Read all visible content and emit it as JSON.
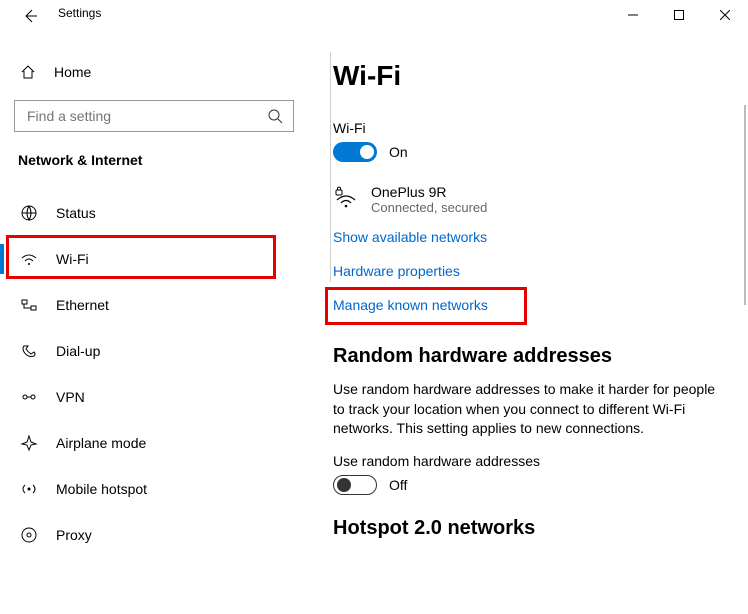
{
  "window": {
    "title": "Settings"
  },
  "sidebar": {
    "home": "Home",
    "search_placeholder": "Find a setting",
    "section": "Network & Internet",
    "items": [
      {
        "label": "Status"
      },
      {
        "label": "Wi-Fi"
      },
      {
        "label": "Ethernet"
      },
      {
        "label": "Dial-up"
      },
      {
        "label": "VPN"
      },
      {
        "label": "Airplane mode"
      },
      {
        "label": "Mobile hotspot"
      },
      {
        "label": "Proxy"
      }
    ]
  },
  "main": {
    "title": "Wi-Fi",
    "wifi_label": "Wi-Fi",
    "wifi_state": "On",
    "network": {
      "name": "OnePlus 9R",
      "status": "Connected, secured"
    },
    "links": {
      "show_available": "Show available networks",
      "hardware_props": "Hardware properties",
      "manage_known": "Manage known networks"
    },
    "random": {
      "heading": "Random hardware addresses",
      "desc": "Use random hardware addresses to make it harder for people to track your location when you connect to different Wi-Fi networks. This setting applies to new connections.",
      "toggle_label": "Use random hardware addresses",
      "toggle_state": "Off"
    },
    "hotspot_heading": "Hotspot 2.0 networks"
  }
}
